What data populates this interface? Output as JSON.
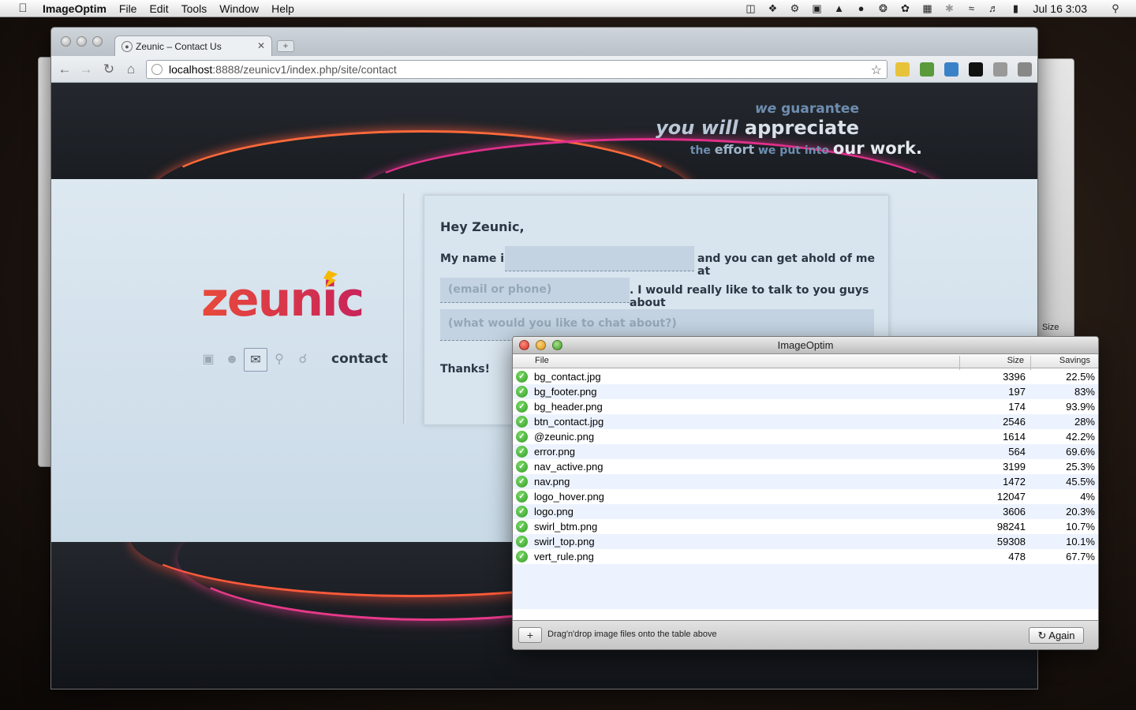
{
  "menubar": {
    "apple": "",
    "app_name": "ImageOptim",
    "menus": [
      "File",
      "Edit",
      "Tools",
      "Window",
      "Help"
    ],
    "clock": "Jul 16  3:03"
  },
  "browser": {
    "tab_title": "Zeunic – Contact Us",
    "url_host": "localhost",
    "url_path": ":8888/zeunicv1/index.php/site/contact"
  },
  "site": {
    "tagline": {
      "we": "we",
      "guarantee": "guarantee",
      "you_will": "you will",
      "appreciate": "appreciate",
      "the": "the",
      "effort": "effort",
      "we_put_into": "we put into",
      "our_work": "our work."
    },
    "logo_text": "zeunic",
    "nav_active_label": "contact",
    "form": {
      "greeting": "Hey Zeunic,",
      "my_name_is": "My name is",
      "name_value": "",
      "get_ahold": "and you can get ahold of me at",
      "contact_placeholder": "(email or phone)",
      "talk_about": ". I would really like to talk to you guys about",
      "topic_placeholder": "(what would you like to chat about?)",
      "thanks": "Thanks!"
    }
  },
  "imageoptim": {
    "title": "ImageOptim",
    "columns": {
      "file": "File",
      "size": "Size",
      "savings": "Savings"
    },
    "rows": [
      {
        "file": "bg_contact.jpg",
        "size": "3396",
        "savings": "22.5%"
      },
      {
        "file": "bg_footer.png",
        "size": "197",
        "savings": "83%"
      },
      {
        "file": "bg_header.png",
        "size": "174",
        "savings": "93.9%"
      },
      {
        "file": "btn_contact.jpg",
        "size": "2546",
        "savings": "28%"
      },
      {
        "file": "@zeunic.png",
        "size": "1614",
        "savings": "42.2%"
      },
      {
        "file": "error.png",
        "size": "564",
        "savings": "69.6%"
      },
      {
        "file": "nav_active.png",
        "size": "3199",
        "savings": "25.3%"
      },
      {
        "file": "nav.png",
        "size": "1472",
        "savings": "45.5%"
      },
      {
        "file": "logo_hover.png",
        "size": "12047",
        "savings": "4%"
      },
      {
        "file": "logo.png",
        "size": "3606",
        "savings": "20.3%"
      },
      {
        "file": "swirl_btm.png",
        "size": "98241",
        "savings": "10.7%"
      },
      {
        "file": "swirl_top.png",
        "size": "59308",
        "savings": "10.1%"
      },
      {
        "file": "vert_rule.png",
        "size": "478",
        "savings": "67.7%"
      }
    ],
    "add_label": "+",
    "hint": "Drag'n'drop image files onto the table above",
    "again_label": "Again"
  },
  "background_window": {
    "size_header": "Size"
  },
  "colors": {
    "accent_red": "#e84a3a",
    "accent_magenta": "#c8245a",
    "bolt": "#f6b800",
    "ok_green": "#2f9a24"
  }
}
